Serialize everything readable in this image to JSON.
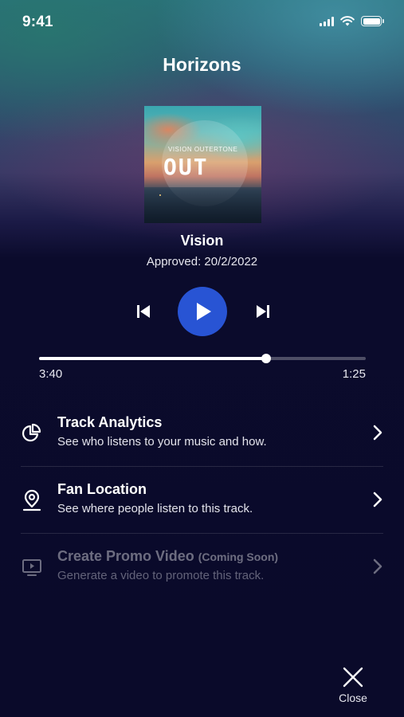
{
  "status_bar": {
    "time": "9:41"
  },
  "header": {
    "title": "Horizons"
  },
  "album": {
    "small_text": "VISION",
    "logo_text": "OUT",
    "brand_text": "OUTERTONE"
  },
  "track": {
    "title": "Vision",
    "approved": "Approved: 20/2/2022"
  },
  "player": {
    "elapsed": "3:40",
    "remaining": "1:25",
    "progress_fraction": 0.696,
    "accent_color": "#2854d4"
  },
  "menu": [
    {
      "title": "Track Analytics",
      "title_suffix": "",
      "subtitle": "See who listens to your music and how.",
      "icon": "pie-chart-icon",
      "enabled": true
    },
    {
      "title": "Fan Location",
      "title_suffix": "",
      "subtitle": "See where people listen to this track.",
      "icon": "location-pin-icon",
      "enabled": true
    },
    {
      "title": "Create Promo Video ",
      "title_suffix": "(Coming Soon)",
      "subtitle": "Generate a video to promote this track.",
      "icon": "monitor-play-icon",
      "enabled": false
    }
  ],
  "close": {
    "label": "Close"
  }
}
